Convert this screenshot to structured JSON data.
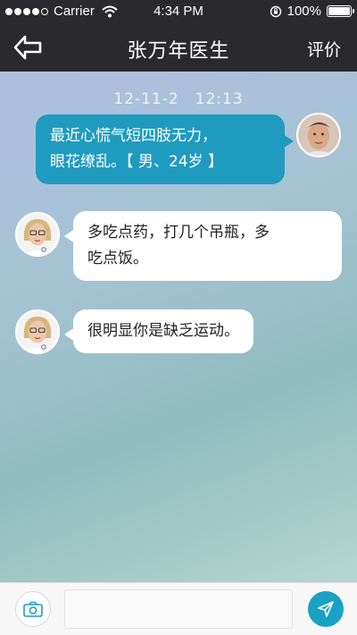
{
  "status_bar": {
    "carrier": "Carrier",
    "time": "4:34 PM",
    "battery": "100%",
    "signal_icon": "signal-dots-icon",
    "wifi_icon": "wifi-icon",
    "lock_icon": "rotation-lock-icon",
    "battery_icon": "battery-icon"
  },
  "nav": {
    "title": "张万年医生",
    "action": "评价",
    "back_icon": "back-arrow-icon"
  },
  "chat": {
    "timestamp": "12-11-2　12:13",
    "messages": [
      {
        "sender": "patient",
        "text": "最近心慌气短四肢无力，\n眼花缭乱。【 男、24岁 】"
      },
      {
        "sender": "doctor",
        "text": "多吃点药，打几个吊瓶，多\n吃点饭。"
      },
      {
        "sender": "doctor",
        "text": "很明显你是缺乏运动。"
      }
    ]
  },
  "input_bar": {
    "placeholder": "",
    "camera_icon": "camera-icon",
    "send_icon": "send-icon"
  },
  "colors": {
    "nav_bg": "#2a2a2e",
    "patient_bubble": "#1f9bc0",
    "doctor_bubble": "#ffffff",
    "send_button": "#1aa2c4"
  }
}
